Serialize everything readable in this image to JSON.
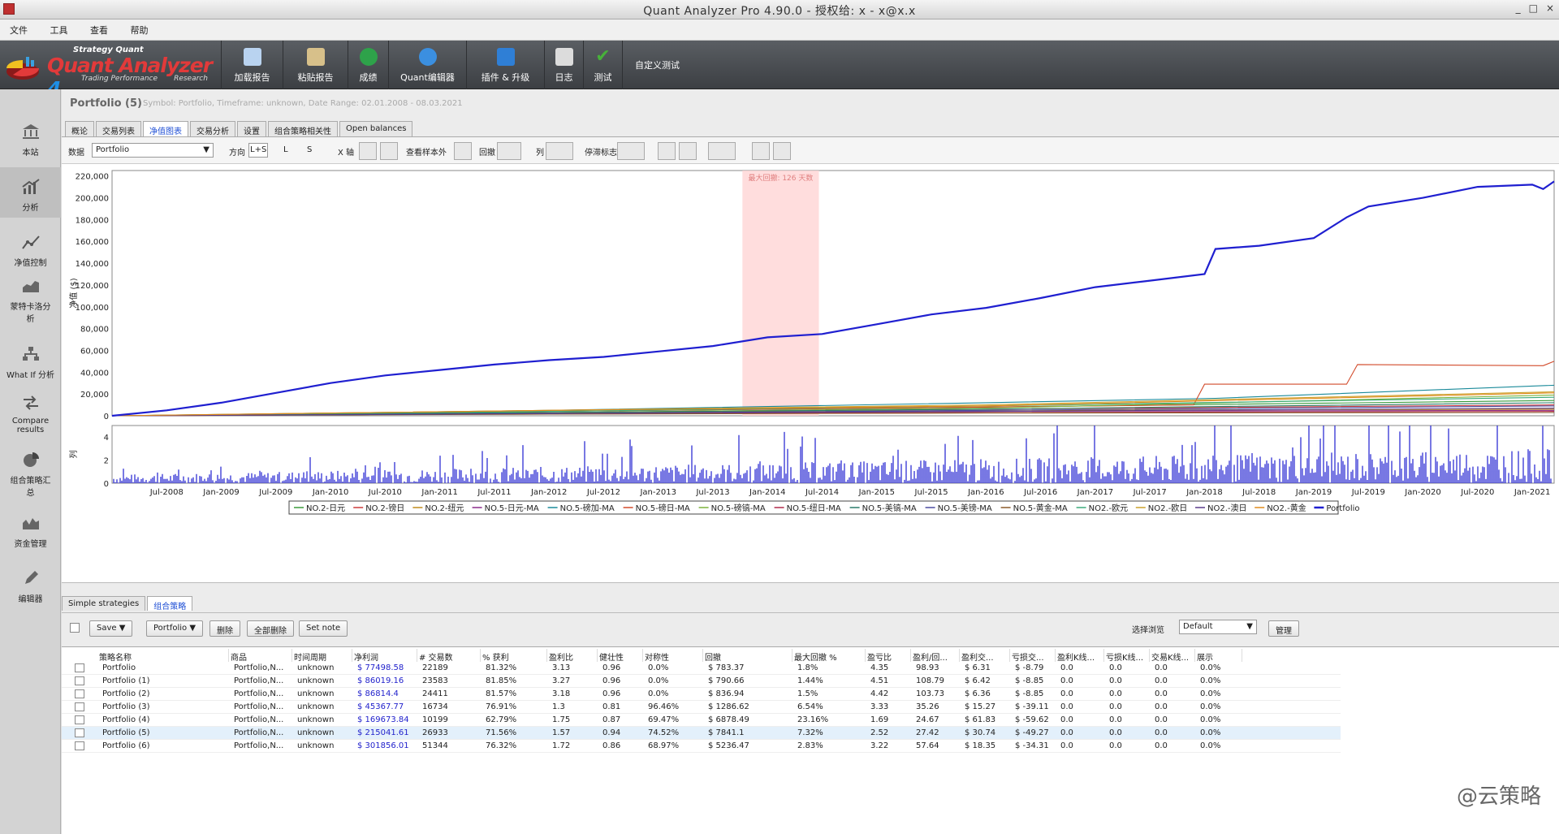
{
  "window": {
    "title": "Quant Analyzer Pro 4.90.0 - 授权给: x - x@x.x",
    "buttons": [
      "_",
      "□",
      "×"
    ]
  },
  "menu": [
    "文件",
    "工具",
    "查看",
    "帮助"
  ],
  "logo": {
    "brand": "Strategy Quant",
    "name": "Quant Analyzer",
    "version": "4",
    "tagline": "Trading Performance",
    "research": "Research"
  },
  "toolbar": [
    {
      "label": "加载报告",
      "icon": "document-icon",
      "color": "#b9d3f0"
    },
    {
      "label": "粘贴报告",
      "icon": "clipboard-icon",
      "color": "#d7c08a"
    },
    {
      "label": "成绩",
      "icon": "dollar-icon",
      "color": "#2ea24a"
    },
    {
      "label": "Quant编辑器",
      "icon": "globe-icon",
      "color": "#3b8fe0"
    },
    {
      "label": "插件 & 升级",
      "icon": "puzzle-icon",
      "color": "#2f7fd6"
    },
    {
      "label": "日志",
      "icon": "log-icon",
      "color": "#dcdcdc"
    },
    {
      "label": "测试",
      "icon": "check-icon",
      "color": "#47b13a"
    },
    {
      "label": "自定义测试",
      "icon": "",
      "color": ""
    }
  ],
  "sidebar": [
    {
      "label": "本站",
      "icon": "bank-icon"
    },
    {
      "label": "分析",
      "icon": "analysis-icon"
    },
    {
      "label": "净值控制",
      "icon": "equity-control-icon"
    },
    {
      "label": "蒙特卡洛分\n析",
      "icon": "montecarlo-icon"
    },
    {
      "label": "What If 分析",
      "icon": "whatif-icon"
    },
    {
      "label": "Compare\nresults",
      "icon": "compare-icon"
    },
    {
      "label": "组合策略汇\n总",
      "icon": "pie-icon"
    },
    {
      "label": "资金管理",
      "icon": "money-management-icon"
    },
    {
      "label": "编辑器",
      "icon": "pencil-icon"
    }
  ],
  "header": {
    "title": "Portfolio (5)",
    "meta": "Symbol: Portfolio, Timeframe: unknown, Date Range: 02.01.2008 - 08.03.2021"
  },
  "tabs": [
    "概论",
    "交易列表",
    "净值图表",
    "交易分析",
    "设置",
    "组合策略相关性",
    "Open balances"
  ],
  "active_tab": 2,
  "chartbar": {
    "data_label": "数据",
    "data_value": "Portfolio",
    "direction_label": "方向",
    "dir_options": [
      "L+S",
      "L",
      "S"
    ],
    "xaxis_label": "X 轴",
    "oos_label": "查看样本外",
    "drawdown_label": "回撤",
    "col_label": "列",
    "stagnation_label": "停滞标志"
  },
  "chart_data": {
    "type": "line",
    "ylabel": "净值 ($)",
    "ylabel2": "列",
    "ylim": [
      0,
      225000
    ],
    "yticks": [
      "0",
      "20,000",
      "40,000",
      "60,000",
      "80,000",
      "100,000",
      "120,000",
      "140,000",
      "160,000",
      "180,000",
      "200,000",
      "220,000"
    ],
    "y2ticks": [
      "0",
      "2",
      "4"
    ],
    "xticks": [
      "Jul-2008",
      "Jan-2009",
      "Jul-2009",
      "Jan-2010",
      "Jul-2010",
      "Jan-2011",
      "Jul-2011",
      "Jan-2012",
      "Jul-2012",
      "Jan-2013",
      "Jul-2013",
      "Jan-2014",
      "Jul-2014",
      "Jan-2015",
      "Jul-2015",
      "Jan-2016",
      "Jul-2016",
      "Jan-2017",
      "Jul-2017",
      "Jan-2018",
      "Jul-2018",
      "Jan-2019",
      "Jul-2019",
      "Jan-2020",
      "Jul-2020",
      "Jan-2021"
    ],
    "drawdown_label": "最大回撤: 126 天数",
    "x_start": 2008.0,
    "x_end": 2021.2,
    "series": [
      {
        "name": "NO.2-日元",
        "color": "#3a9a3a",
        "points": [
          [
            2008.0,
            0
          ],
          [
            2012,
            4000
          ],
          [
            2016,
            8000
          ],
          [
            2021.2,
            14000
          ]
        ]
      },
      {
        "name": "NO.2-镑日",
        "color": "#cc3a3a",
        "points": [
          [
            2008.0,
            0
          ],
          [
            2012,
            3000
          ],
          [
            2016,
            6000
          ],
          [
            2021.2,
            10000
          ]
        ]
      },
      {
        "name": "NO.2-纽元",
        "color": "#c08a1a",
        "points": [
          [
            2008.0,
            0
          ],
          [
            2012,
            2500
          ],
          [
            2016,
            5000
          ],
          [
            2021.2,
            6000
          ]
        ]
      },
      {
        "name": "NO.5-日元-MA",
        "color": "#8a2a8a",
        "points": [
          [
            2008.0,
            0
          ],
          [
            2012,
            2000
          ],
          [
            2016,
            4000
          ],
          [
            2021.2,
            5000
          ]
        ]
      },
      {
        "name": "NO.5-磅加-MA",
        "color": "#1a8a9a",
        "points": [
          [
            2008.0,
            0
          ],
          [
            2012,
            5000
          ],
          [
            2016,
            12000
          ],
          [
            2018.1,
            16000
          ],
          [
            2021.2,
            28000
          ]
        ]
      },
      {
        "name": "NO.5-磅日-MA",
        "color": "#d24a2a",
        "points": [
          [
            2008.0,
            0
          ],
          [
            2012,
            4000
          ],
          [
            2016,
            8000
          ],
          [
            2017.9,
            10000
          ],
          [
            2018.0,
            29000
          ],
          [
            2019.3,
            29000
          ],
          [
            2019.4,
            47000
          ],
          [
            2021.1,
            46000
          ],
          [
            2021.2,
            50000
          ]
        ]
      },
      {
        "name": "NO.5-磅镐-MA",
        "color": "#7ab23a",
        "points": [
          [
            2008.0,
            0
          ],
          [
            2012,
            3000
          ],
          [
            2016,
            7000
          ],
          [
            2021.2,
            19000
          ]
        ]
      },
      {
        "name": "NO.5-纽日-MA",
        "color": "#b02a4a",
        "points": [
          [
            2008.0,
            0
          ],
          [
            2012,
            2000
          ],
          [
            2016,
            3000
          ],
          [
            2021.2,
            4000
          ]
        ]
      },
      {
        "name": "NO.5-美镐-MA",
        "color": "#2a7a6a",
        "points": [
          [
            2008.0,
            0
          ],
          [
            2012,
            3000
          ],
          [
            2016,
            6000
          ],
          [
            2021.2,
            12000
          ]
        ]
      },
      {
        "name": "NO.5-美镑-MA",
        "color": "#4a4aa0",
        "points": [
          [
            2008.0,
            0
          ],
          [
            2012,
            2000
          ],
          [
            2016,
            5000
          ],
          [
            2021.2,
            9000
          ]
        ]
      },
      {
        "name": "NO.5-黄金-MA",
        "color": "#8a5a2a",
        "points": [
          [
            2008.0,
            0
          ],
          [
            2012,
            1500
          ],
          [
            2016,
            2500
          ],
          [
            2021.2,
            3000
          ]
        ]
      },
      {
        "name": "NO2.-欧元",
        "color": "#3aaa7a",
        "points": [
          [
            2008.0,
            0
          ],
          [
            2012,
            4000
          ],
          [
            2016,
            9000
          ],
          [
            2021.2,
            17000
          ]
        ]
      },
      {
        "name": "NO2.-欧日",
        "color": "#caa02a",
        "points": [
          [
            2008.0,
            0
          ],
          [
            2012,
            5000
          ],
          [
            2016,
            10000
          ],
          [
            2021.2,
            22000
          ]
        ]
      },
      {
        "name": "NO2.-澳日",
        "color": "#5a3a8a",
        "points": [
          [
            2008.0,
            0
          ],
          [
            2012,
            2000
          ],
          [
            2016,
            4000
          ],
          [
            2021.2,
            7000
          ]
        ]
      },
      {
        "name": "NO2.-黄金",
        "color": "#e08a1a",
        "points": [
          [
            2008.0,
            0
          ],
          [
            2012,
            5000
          ],
          [
            2016,
            9000
          ],
          [
            2021.2,
            21000
          ]
        ]
      },
      {
        "name": "Portfolio",
        "color": "#1f1fd0",
        "points": [
          [
            2008.0,
            0
          ],
          [
            2008.5,
            5000
          ],
          [
            2009.0,
            12000
          ],
          [
            2009.5,
            21000
          ],
          [
            2010.0,
            30000
          ],
          [
            2010.5,
            37000
          ],
          [
            2011.0,
            42000
          ],
          [
            2011.5,
            47000
          ],
          [
            2012.0,
            51000
          ],
          [
            2012.5,
            54000
          ],
          [
            2013.0,
            59000
          ],
          [
            2013.5,
            64000
          ],
          [
            2014.0,
            72000
          ],
          [
            2014.5,
            75000
          ],
          [
            2015.0,
            84000
          ],
          [
            2015.5,
            93000
          ],
          [
            2016.0,
            99000
          ],
          [
            2016.5,
            108000
          ],
          [
            2017.0,
            118000
          ],
          [
            2017.5,
            124000
          ],
          [
            2018.0,
            130000
          ],
          [
            2018.1,
            153000
          ],
          [
            2018.5,
            156000
          ],
          [
            2019.0,
            163000
          ],
          [
            2019.3,
            182000
          ],
          [
            2019.5,
            192000
          ],
          [
            2020.0,
            200000
          ],
          [
            2020.5,
            210000
          ],
          [
            2021.0,
            212000
          ],
          [
            2021.1,
            208000
          ],
          [
            2021.2,
            215000
          ]
        ]
      }
    ]
  },
  "lower_tabs": [
    "Simple strategies",
    "组合策略"
  ],
  "lower_active": 1,
  "actions": {
    "save": "Save ▼",
    "portfolio": "Portfolio ▼",
    "delete": "删除",
    "delete_all": "全部删除",
    "set_note": "Set note",
    "view_label": "选择浏览",
    "view_value": "Default",
    "manage": "管理"
  },
  "table": {
    "columns": [
      "策略名称",
      "商品",
      "时间周期",
      "净利润",
      "# 交易数",
      "% 获利",
      "盈利比",
      "健壮性",
      "对称性",
      "回撤",
      "最大回撤 %",
      "盈亏比",
      "盈利/回...",
      "盈利交...",
      "亏损交...",
      "盈利K线...",
      "亏损K线...",
      "交易K线...",
      "展示"
    ],
    "rows": [
      [
        "Portfolio",
        "Portfolio,N...",
        "unknown",
        "$ 77498.58",
        "22189",
        "81.32%",
        "3.13",
        "0.96",
        "0.0%",
        "$ 783.37",
        "1.8%",
        "4.35",
        "98.93",
        "$ 6.31",
        "$ -8.79",
        "0.0",
        "0.0",
        "0.0",
        "0.0%"
      ],
      [
        "Portfolio (1)",
        "Portfolio,N...",
        "unknown",
        "$ 86019.16",
        "23583",
        "81.85%",
        "3.27",
        "0.96",
        "0.0%",
        "$ 790.66",
        "1.44%",
        "4.51",
        "108.79",
        "$ 6.42",
        "$ -8.85",
        "0.0",
        "0.0",
        "0.0",
        "0.0%"
      ],
      [
        "Portfolio (2)",
        "Portfolio,N...",
        "unknown",
        "$ 86814.4",
        "24411",
        "81.57%",
        "3.18",
        "0.96",
        "0.0%",
        "$ 836.94",
        "1.5%",
        "4.42",
        "103.73",
        "$ 6.36",
        "$ -8.85",
        "0.0",
        "0.0",
        "0.0",
        "0.0%"
      ],
      [
        "Portfolio (3)",
        "Portfolio,N...",
        "unknown",
        "$ 45367.77",
        "16734",
        "76.91%",
        "1.3",
        "0.81",
        "96.46%",
        "$ 1286.62",
        "6.54%",
        "3.33",
        "35.26",
        "$ 15.27",
        "$ -39.11",
        "0.0",
        "0.0",
        "0.0",
        "0.0%"
      ],
      [
        "Portfolio (4)",
        "Portfolio,N...",
        "unknown",
        "$ 169673.84",
        "10199",
        "62.79%",
        "1.75",
        "0.87",
        "69.47%",
        "$ 6878.49",
        "23.16%",
        "1.69",
        "24.67",
        "$ 61.83",
        "$ -59.62",
        "0.0",
        "0.0",
        "0.0",
        "0.0%"
      ],
      [
        "Portfolio (5)",
        "Portfolio,N...",
        "unknown",
        "$ 215041.61",
        "26933",
        "71.56%",
        "1.57",
        "0.94",
        "74.52%",
        "$ 7841.1",
        "7.32%",
        "2.52",
        "27.42",
        "$ 30.74",
        "$ -49.27",
        "0.0",
        "0.0",
        "0.0",
        "0.0%"
      ],
      [
        "Portfolio (6)",
        "Portfolio,N...",
        "unknown",
        "$ 301856.01",
        "51344",
        "76.32%",
        "1.72",
        "0.86",
        "68.97%",
        "$ 5236.47",
        "2.83%",
        "3.22",
        "57.64",
        "$ 18.35",
        "$ -34.31",
        "0.0",
        "0.0",
        "0.0",
        "0.0%"
      ]
    ],
    "selected_row": 5
  },
  "watermark": "@云策略"
}
